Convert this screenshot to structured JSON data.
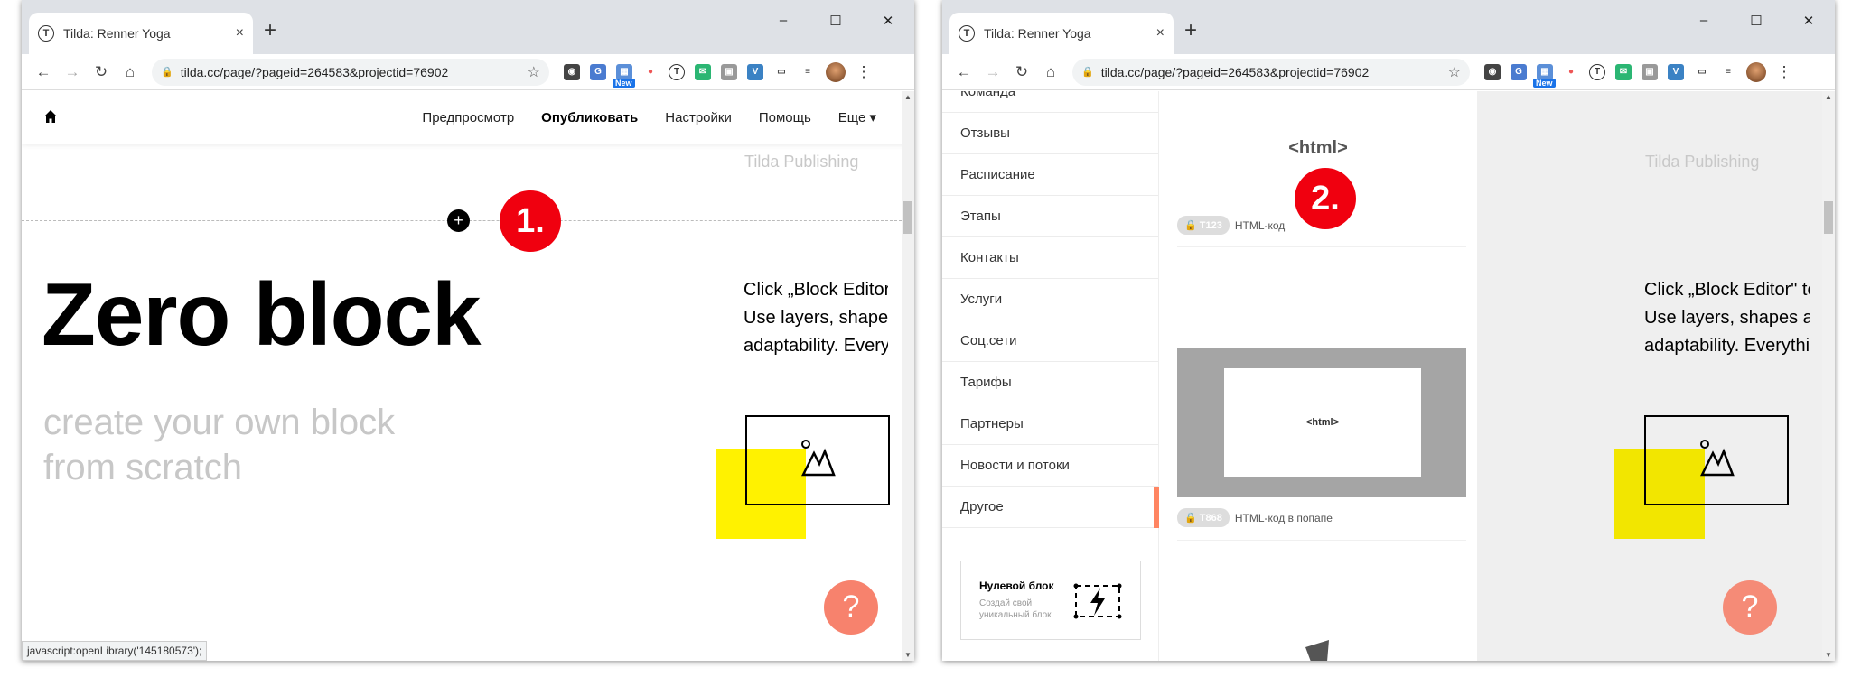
{
  "browser": {
    "tab_title": "Tilda: Renner Yoga",
    "tab_close": "×",
    "new_tab": "+",
    "url": "tilda.cc/page/?pageid=264583&projectid=76902",
    "window_controls": [
      "–",
      "☐",
      "✕"
    ],
    "nav_icons": [
      "←",
      "→",
      "↻",
      "⌂"
    ],
    "star": "☆",
    "kebab": "⋮",
    "ext_new_badge": "New"
  },
  "left": {
    "menu": [
      "Предпросмотр",
      "Опубликовать",
      "Настройки",
      "Помощь",
      "Еще ▾"
    ],
    "tilda_label": "Tilda Publishing",
    "plus": "+",
    "step": "1.",
    "title": "Zero block",
    "subtitle": "create your own block from scratch",
    "desc_lines": [
      "Click „Block Editor\" to",
      "Use layers, shapes a",
      "adaptability. Everythi"
    ],
    "help": "?",
    "status": "javascript:openLibrary('145180573');"
  },
  "right": {
    "categories": [
      "Команда",
      "Отзывы",
      "Расписание",
      "Этапы",
      "Контакты",
      "Услуги",
      "Соц.сети",
      "Тарифы",
      "Партнеры",
      "Новости и потоки",
      "Другое"
    ],
    "active_category": "Другое",
    "zero_block_card": {
      "title": "Нулевой блок",
      "subtitle": "Создай свой уникальный блок"
    },
    "html_tag": "<html>",
    "step": "2.",
    "blocks": [
      {
        "code": "T123",
        "label": "HTML-код"
      },
      {
        "code": "T868",
        "label": "HTML-код в попапе"
      }
    ],
    "thumb_tag": "<html>",
    "tilda_label": "Tilda Publishing",
    "desc_lines": [
      "Click „Block Editor\" tc",
      "Use layers, shapes a",
      "adaptability. Everythi"
    ],
    "help": "?"
  },
  "colors": {
    "accent_red": "#f0000f",
    "help_orange": "#f7826d",
    "yellow": "#fff200",
    "active_bar": "#ff8562"
  }
}
